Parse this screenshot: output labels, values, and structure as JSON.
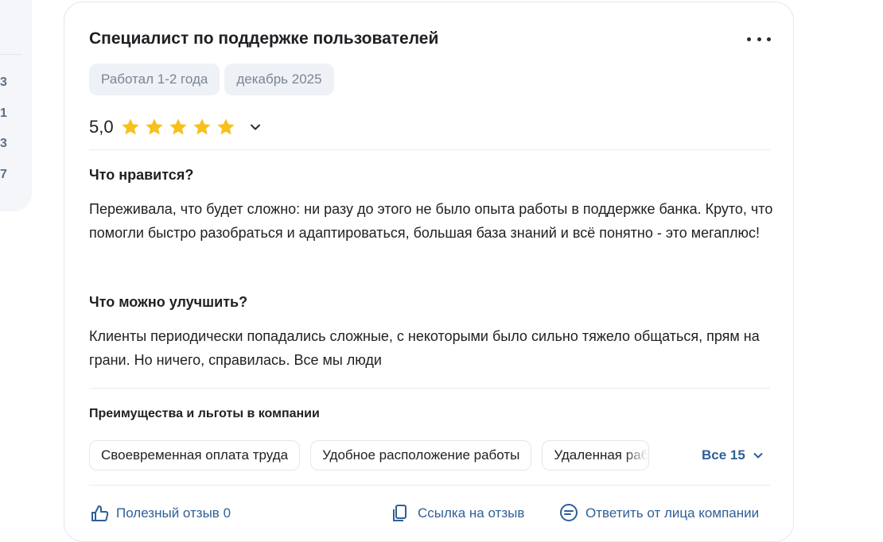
{
  "sidebar": {
    "numbers": [
      "3",
      "1",
      "3",
      "7"
    ]
  },
  "review": {
    "title": "Специалист по поддержке пользователей",
    "tags": [
      "Работал 1-2 года",
      "декабрь 2025"
    ],
    "rating": "5,0",
    "stars": 5,
    "likes_heading": "Что нравится?",
    "likes_text": "Переживала, что будет сложно: ни разу до этого не было опыта работы в поддержке банка. Круто, что помогли быстро разобраться и адаптироваться, большая база знаний и всё понятно - это мегаплюс!",
    "improve_heading": "Что можно улучшить?",
    "improve_text": "Клиенты периодически попадались сложные, с некоторыми было сильно тяжело общаться, прям на грани. Но ничего, справилась. Все мы люди",
    "benefits_heading": "Преимущества и льготы в компании",
    "benefits": [
      "Своевременная оплата труда",
      "Удобное расположение работы",
      "Удаленная работа"
    ],
    "all_benefits_label": "Все 15"
  },
  "actions": {
    "helpful_label": "Полезный отзыв",
    "helpful_count": "0",
    "link_label": "Ссылка на отзыв",
    "reply_label": "Ответить от лица компании"
  },
  "colors": {
    "star": "#f8c01b",
    "link": "#2f5f96",
    "tag_bg": "#eef1f5"
  }
}
